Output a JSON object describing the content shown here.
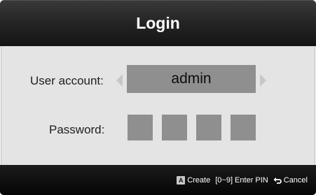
{
  "dialog": {
    "title": "Login"
  },
  "form": {
    "user_account_label": "User account:",
    "user_account_value": "admin",
    "password_label": "Password:",
    "pin_digits": 4
  },
  "hints": {
    "create_key": "A",
    "create_label": "Create",
    "pin_label": "[0~9] Enter PIN",
    "cancel_label": "Cancel"
  },
  "icons": {
    "prev": "chevron-left-icon",
    "next": "chevron-right-icon",
    "return": "return-icon"
  }
}
